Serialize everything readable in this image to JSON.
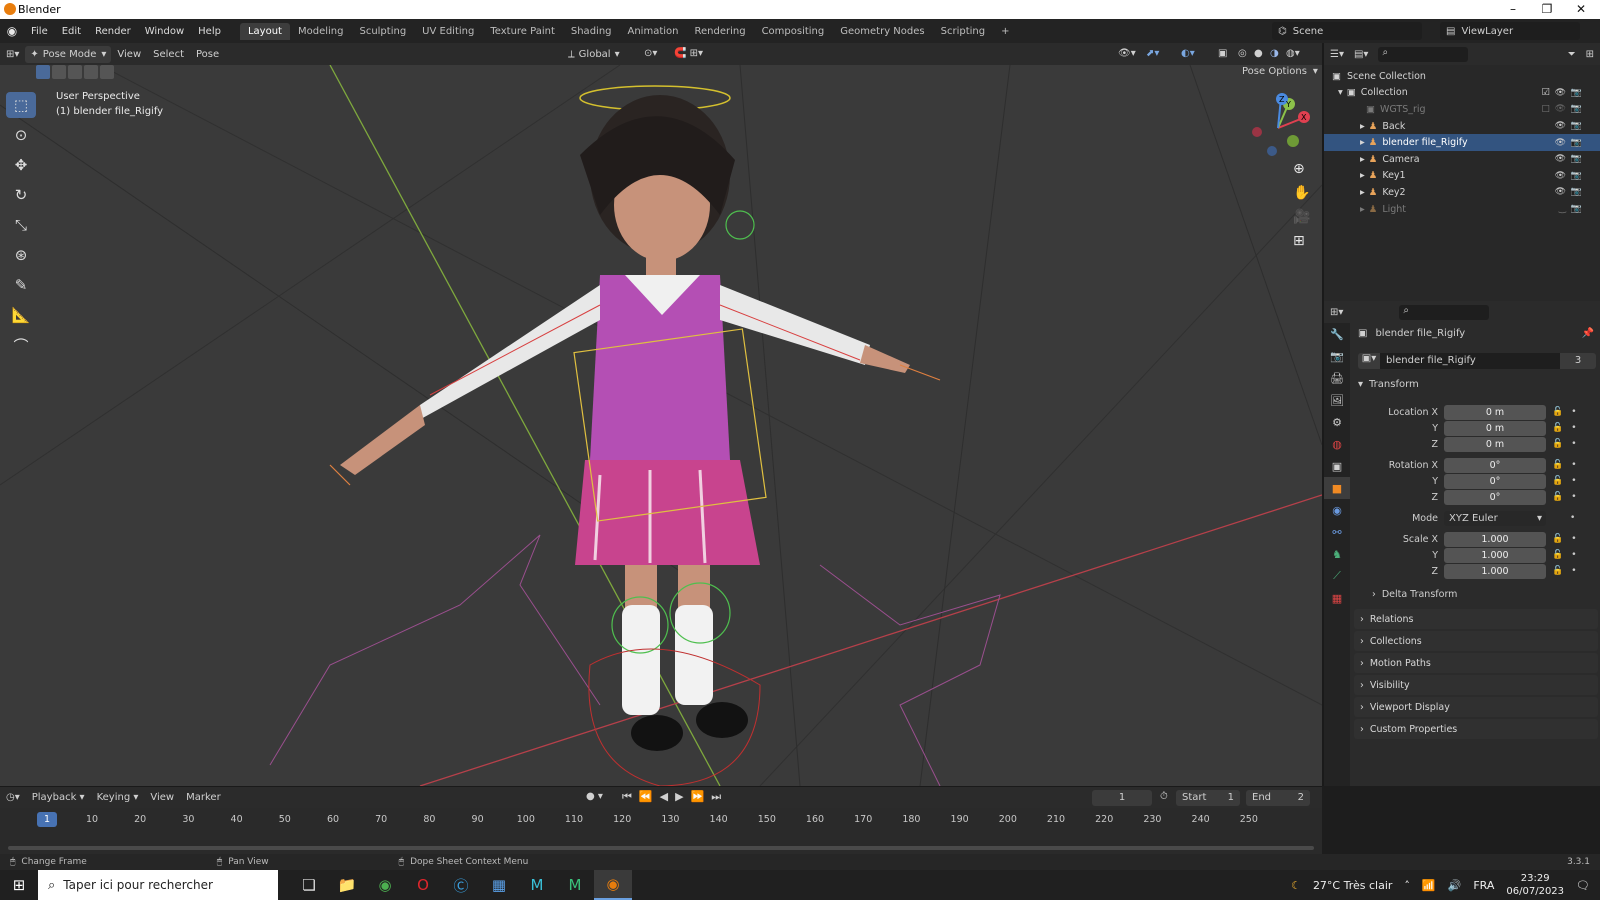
{
  "window": {
    "title": "Blender"
  },
  "menubar": {
    "items": [
      "File",
      "Edit",
      "Render",
      "Window",
      "Help"
    ],
    "workspaces": [
      "Layout",
      "Modeling",
      "Sculpting",
      "UV Editing",
      "Texture Paint",
      "Shading",
      "Animation",
      "Rendering",
      "Compositing",
      "Geometry Nodes",
      "Scripting"
    ],
    "active_workspace": "Layout",
    "add_tab": "+",
    "scene": "Scene",
    "view_layer": "ViewLayer"
  },
  "viewport_header": {
    "mode": "Pose Mode",
    "menus": [
      "View",
      "Select",
      "Pose"
    ],
    "transform_orientation": "Global",
    "pose_options": "Pose Options"
  },
  "viewport": {
    "perspective_label": "User Perspective",
    "object_label": "(1) blender file_Rigify",
    "gizmo_axes": [
      "X",
      "Y",
      "Z"
    ]
  },
  "outliner": {
    "root": "Scene Collection",
    "collection": "Collection",
    "items": [
      {
        "name": "WGTS_rig",
        "dim": true,
        "selected": false
      },
      {
        "name": "Back",
        "dim": false,
        "selected": false
      },
      {
        "name": "blender file_Rigify",
        "dim": false,
        "selected": true
      },
      {
        "name": "Camera",
        "dim": false,
        "selected": false
      },
      {
        "name": "Key1",
        "dim": false,
        "selected": false
      },
      {
        "name": "Key2",
        "dim": false,
        "selected": false
      },
      {
        "name": "Light",
        "dim": true,
        "selected": false
      }
    ]
  },
  "properties": {
    "object_name": "blender file_Rigify",
    "datablock_name": "blender file_Rigify",
    "datablock_users": "3",
    "transform_label": "Transform",
    "location": {
      "label": "Location X",
      "x": "0 m",
      "y": "0 m",
      "z": "0 m"
    },
    "rotation": {
      "label": "Rotation X",
      "x": "0°",
      "y": "0°",
      "z": "0°"
    },
    "mode_label": "Mode",
    "mode_value": "XYZ Euler",
    "scale": {
      "label": "Scale X",
      "x": "1.000",
      "y": "1.000",
      "z": "1.000"
    },
    "axis_y": "Y",
    "axis_z": "Z",
    "sub_panels": [
      "Delta Transform"
    ],
    "panels": [
      "Relations",
      "Collections",
      "Motion Paths",
      "Visibility",
      "Viewport Display",
      "Custom Properties"
    ]
  },
  "timeline": {
    "menus": [
      "Playback",
      "Keying",
      "View",
      "Marker"
    ],
    "current_frame": "1",
    "start_label": "Start",
    "start": "1",
    "end_label": "End",
    "end": "2",
    "ticks": [
      "1",
      "10",
      "20",
      "30",
      "40",
      "50",
      "60",
      "70",
      "80",
      "90",
      "100",
      "110",
      "120",
      "130",
      "140",
      "150",
      "160",
      "170",
      "180",
      "190",
      "200",
      "210",
      "220",
      "230",
      "240",
      "250"
    ]
  },
  "statusbar": {
    "hint1": "Change Frame",
    "hint2": "Pan View",
    "hint3": "Dope Sheet Context Menu",
    "version": "3.3.1"
  },
  "taskbar": {
    "search_placeholder": "Taper ici pour rechercher",
    "weather": "27°C  Très clair",
    "language": "FRA",
    "time": "23:29",
    "date": "06/07/2023"
  },
  "colors": {
    "accent": "#4772b3",
    "selection": "#335480",
    "x_axis": "#e04050",
    "y_axis": "#8cc14a",
    "z_axis": "#4a8ae0"
  }
}
